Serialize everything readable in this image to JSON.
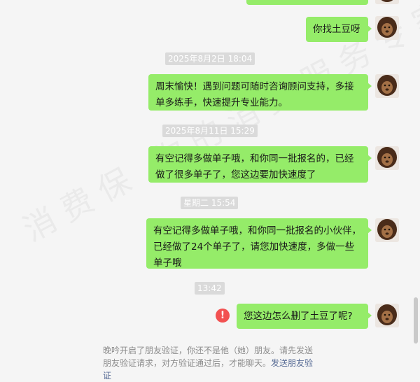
{
  "watermark": "消费保 你的消费服务专家",
  "messages": [
    {
      "text": ""
    },
    {
      "text": "你找土豆呀"
    },
    {
      "text": "周末愉快！遇到问题可随时咨询顾问支持，多接单多练手，快速提升专业能力。"
    },
    {
      "text": "有空记得多做单子哦，和你同一批报名的，已经做了很多单子了，您这边要加快速度了"
    },
    {
      "text": "有空记得多做单子哦，和你同一批报名的小伙伴，已经做了24个单子了，请您加快速度，多做一些单子哦"
    },
    {
      "text": "您这边怎么删了土豆了呢?"
    }
  ],
  "timestamps": [
    "2025年8月2日 18:04",
    "2025年8月11日 15:29",
    "星期二 15:54",
    "13:42"
  ],
  "error_icon": "!",
  "system_note": {
    "text": "晚吟开启了朋友验证，你还不是他（她）朋友。请先发送朋友验证请求，对方验证通过后，才能聊天。",
    "link": "发送朋友验证"
  },
  "colors": {
    "bubble": "#95ec69",
    "link": "#576b95",
    "error": "#f25151",
    "background": "#f5f5f5"
  }
}
